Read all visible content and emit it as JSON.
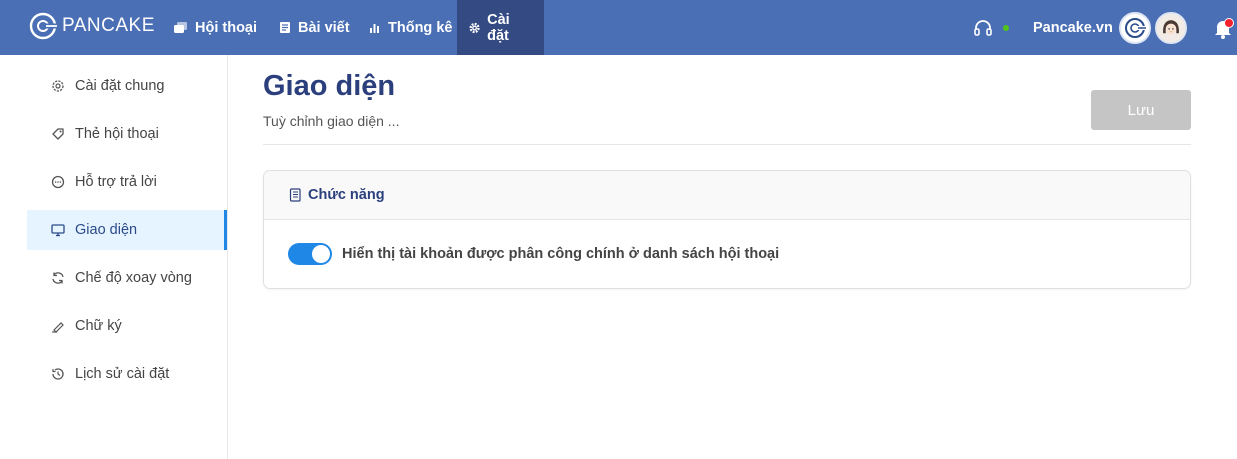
{
  "app": {
    "name": "PANCAKE",
    "brand_color": "#4a6fb5",
    "active_color": "#334a83"
  },
  "nav": {
    "items": [
      {
        "label": "Hội thoại",
        "icon": "chat-icon"
      },
      {
        "label": "Bài viết",
        "icon": "post-icon"
      },
      {
        "label": "Thống kê",
        "icon": "chart-icon"
      },
      {
        "label": "Cài đặt",
        "icon": "gear-icon",
        "active": true
      }
    ]
  },
  "header_right": {
    "shop_name": "Pancake.vn",
    "status_color": "#52c41a"
  },
  "sidebar": {
    "items": [
      {
        "label": "Cài đặt chung",
        "icon": "gear-icon"
      },
      {
        "label": "Thẻ hội thoại",
        "icon": "tag-icon"
      },
      {
        "label": "Hỗ trợ trả lời",
        "icon": "message-dots-icon"
      },
      {
        "label": "Giao diện",
        "icon": "monitor-icon",
        "active": true
      },
      {
        "label": "Chế độ xoay vòng",
        "icon": "rotate-icon"
      },
      {
        "label": "Chữ ký",
        "icon": "signature-icon"
      },
      {
        "label": "Lịch sử cài đặt",
        "icon": "history-icon"
      }
    ]
  },
  "page": {
    "title": "Giao diện",
    "subtitle": "Tuỳ chỉnh giao diện ...",
    "save_label": "Lưu"
  },
  "card": {
    "title": "Chức năng",
    "toggle_label": "Hiển thị tài khoản được phân công chính ở danh sách hội thoại",
    "toggle_on": true
  }
}
